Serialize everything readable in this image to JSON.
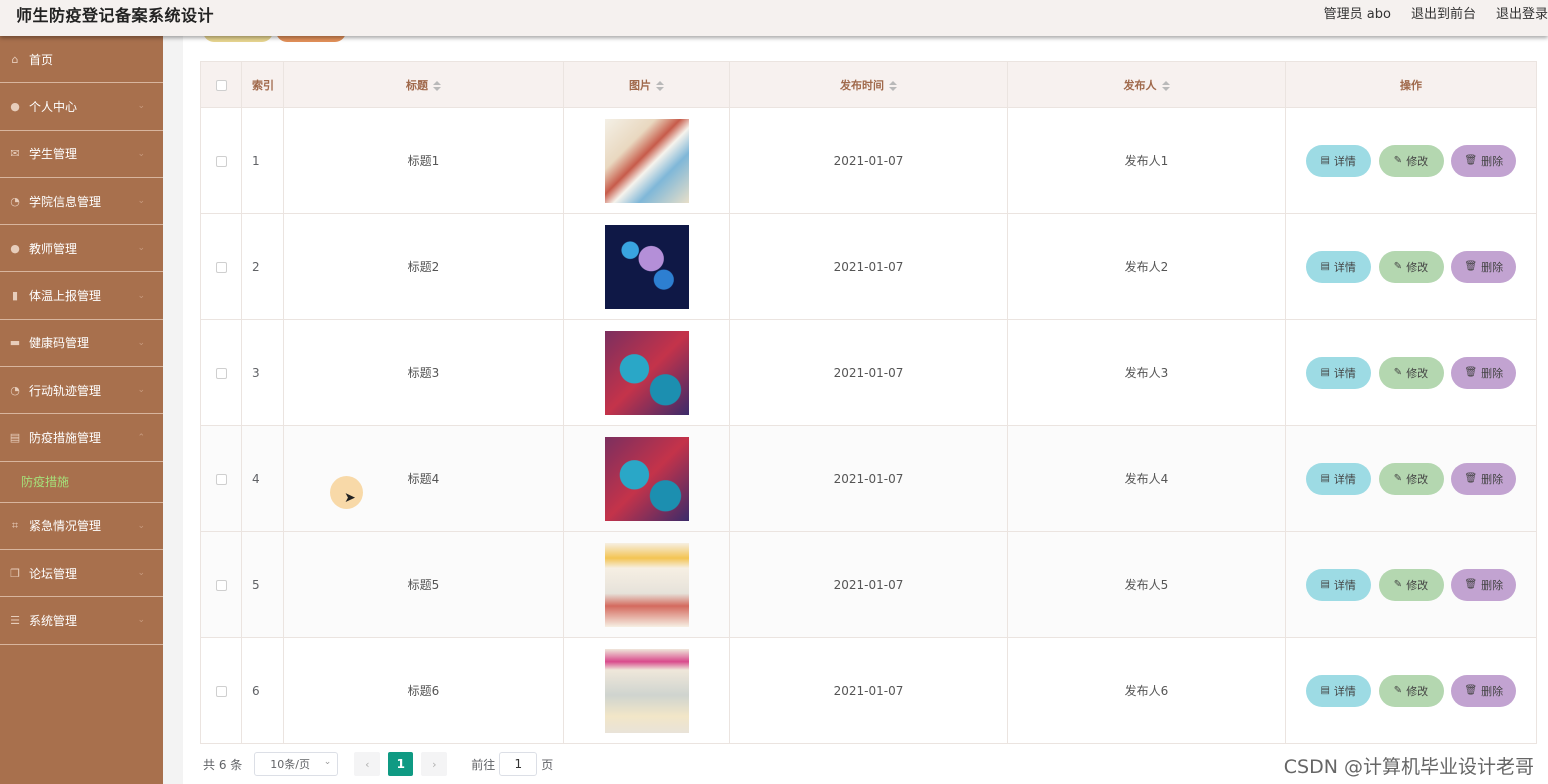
{
  "header": {
    "title": "师生防疫登记备案系统设计",
    "admin_label": "管理员 abo",
    "to_front_label": "退出到前台",
    "logout_label": "退出登录"
  },
  "sidebar": {
    "items": [
      {
        "label": "首页",
        "icon": "home-icon"
      },
      {
        "label": "个人中心",
        "icon": "user-icon"
      },
      {
        "label": "学生管理",
        "icon": "mail-icon"
      },
      {
        "label": "学院信息管理",
        "icon": "clock-icon"
      },
      {
        "label": "教师管理",
        "icon": "user-icon"
      },
      {
        "label": "体温上报管理",
        "icon": "bar-chart-icon"
      },
      {
        "label": "健康码管理",
        "icon": "briefcase-icon"
      },
      {
        "label": "行动轨迹管理",
        "icon": "clock-icon"
      },
      {
        "label": "防疫措施管理",
        "icon": "document-icon"
      },
      {
        "label": "紧急情况管理",
        "icon": "crop-icon"
      },
      {
        "label": "论坛管理",
        "icon": "copy-icon"
      },
      {
        "label": "系统管理",
        "icon": "list-icon"
      }
    ],
    "sub_item": "防疫措施"
  },
  "table": {
    "headers": {
      "index": "索引",
      "title": "标题",
      "image": "图片",
      "publish_time": "发布时间",
      "publisher": "发布人",
      "actions": "操作"
    },
    "rows": [
      {
        "index": "1",
        "title": "标题1",
        "publish_time": "2021-01-07",
        "publisher": "发布人1"
      },
      {
        "index": "2",
        "title": "标题2",
        "publish_time": "2021-01-07",
        "publisher": "发布人2"
      },
      {
        "index": "3",
        "title": "标题3",
        "publish_time": "2021-01-07",
        "publisher": "发布人3"
      },
      {
        "index": "4",
        "title": "标题4",
        "publish_time": "2021-01-07",
        "publisher": "发布人4"
      },
      {
        "index": "5",
        "title": "标题5",
        "publish_time": "2021-01-07",
        "publisher": "发布人5"
      },
      {
        "index": "6",
        "title": "标题6",
        "publish_time": "2021-01-07",
        "publisher": "发布人6"
      }
    ],
    "buttons": {
      "detail": "详情",
      "edit": "修改",
      "delete": "删除"
    }
  },
  "pagination": {
    "total": "共 6 条",
    "page_size": "10条/页",
    "current_page": "1",
    "goto_label": "前往",
    "goto_value": "1",
    "page_suffix": "页"
  },
  "watermark": "CSDN @计算机毕业设计老哥",
  "colors": {
    "sidebar_bg": "#a8704d",
    "active_sub": "#a5e07a",
    "page_active": "#0f9a83",
    "btn_detail": "#9ddbe4",
    "btn_edit": "#b4d7b0",
    "btn_delete": "#c2a3d1"
  }
}
